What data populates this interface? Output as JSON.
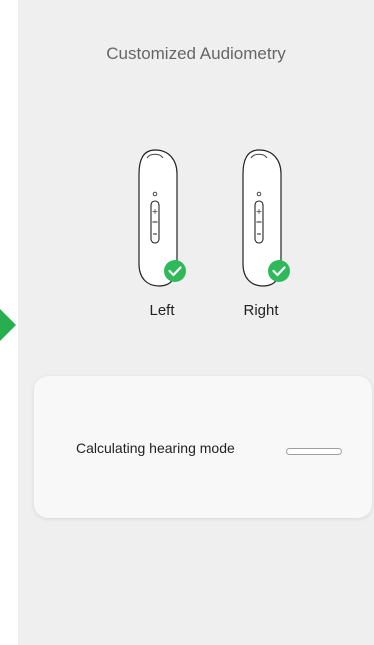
{
  "header": {
    "title": "Customized Audiometry"
  },
  "devices": [
    {
      "label": "Left",
      "status": "check-circle-icon"
    },
    {
      "label": "Right",
      "status": "check-circle-icon"
    }
  ],
  "colors": {
    "check": "#2fb95a",
    "accent_arrow": "#27ae4f"
  },
  "calculation": {
    "status_text": "Calculating hearing mode",
    "progress": 0
  }
}
